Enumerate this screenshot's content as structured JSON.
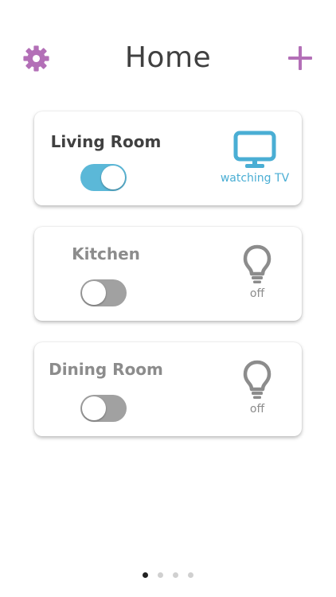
{
  "header": {
    "title": "Home",
    "settings_icon": "gear-icon",
    "add_icon": "plus-icon",
    "accent_color": "#b36fb7"
  },
  "rooms": [
    {
      "name": "Living Room",
      "toggle_on": true,
      "device_icon": "tv-icon",
      "status": "watching TV",
      "name_color": "#404040",
      "status_color": "#4aaed4"
    },
    {
      "name": "Kitchen",
      "toggle_on": false,
      "device_icon": "lightbulb-icon",
      "status": "off",
      "name_color": "#8c8c8c",
      "status_color": "#8c8c8c"
    },
    {
      "name": "Dining Room",
      "toggle_on": false,
      "device_icon": "lightbulb-icon",
      "status": "off",
      "name_color": "#8c8c8c",
      "status_color": "#8c8c8c"
    }
  ],
  "pagination": {
    "count": 4,
    "active_index": 0
  }
}
